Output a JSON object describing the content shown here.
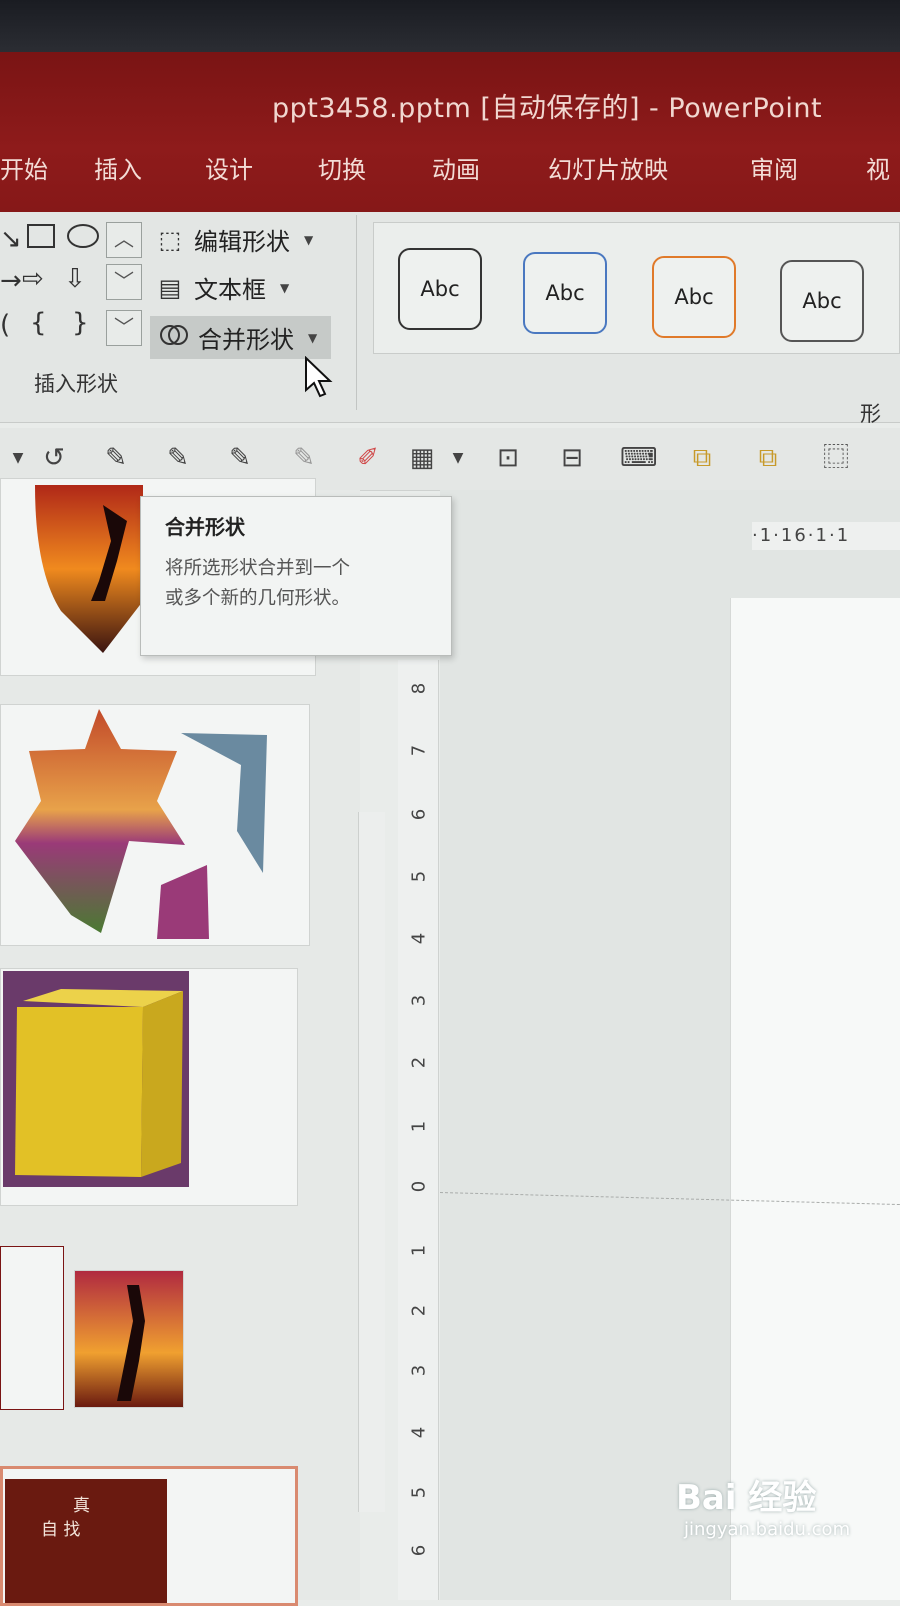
{
  "window": {
    "title": "ppt3458.pptm [自动保存的] - PowerPoint"
  },
  "tabs": [
    "开始",
    "插入",
    "设计",
    "切换",
    "动画",
    "幻灯片放映",
    "审阅",
    "视"
  ],
  "ribbon": {
    "insert_shapes_label": "插入形状",
    "edit_shape_label": "编辑形状",
    "text_box_label": "文本框",
    "merge_shapes_label": "合并形状",
    "shape_styles_label": "形",
    "style_samples": [
      {
        "text": "Abc",
        "border_color": "#333333"
      },
      {
        "text": "Abc",
        "border_color": "#4a78c0"
      },
      {
        "text": "Abc",
        "border_color": "#e07a2a"
      },
      {
        "text": "Abc",
        "border_color": "#555555"
      }
    ]
  },
  "tooltip": {
    "title": "合并形状",
    "line1": "将所选形状合并到一个",
    "line2": "或多个新的几何形状。"
  },
  "ruler": {
    "horizontal_label": "·1·16·1·1",
    "vertical_ticks": [
      "8",
      "7",
      "6",
      "5",
      "4",
      "3",
      "2",
      "1",
      "0",
      "1",
      "2",
      "3",
      "4",
      "5",
      "6"
    ]
  },
  "thumbnail": {
    "last_slide_text_top": "真",
    "last_slide_text_bottom": "自 找"
  },
  "watermark": {
    "logo": "Bai 经验",
    "url": "jingyan.baidu.com"
  },
  "colors": {
    "title_bar": "#8e1b1b",
    "ribbon_bg": "#e3e6e4",
    "cube": "#e2c126"
  }
}
